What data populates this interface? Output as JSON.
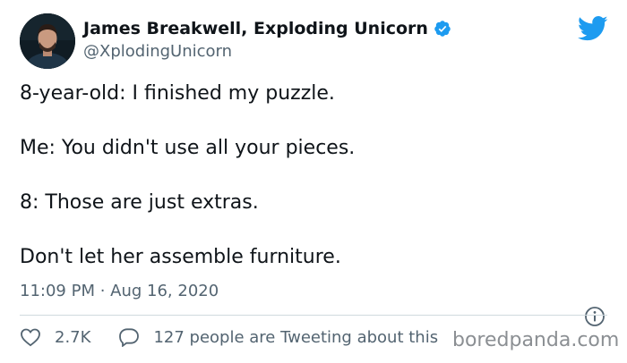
{
  "author": {
    "display_name": "James Breakwell, Exploding Unicorn",
    "handle": "@XplodingUnicorn",
    "avatar_icon": "profile-photo",
    "verified_icon": "verified-badge-icon"
  },
  "tweet": {
    "lines": [
      "8-year-old: I finished my puzzle.",
      "Me: You didn't use all your pieces.",
      "8: Those are just extras.",
      "Don't let her assemble furniture."
    ],
    "timestamp": "11:09 PM · Aug 16, 2020"
  },
  "actions": {
    "like_count": "2.7K",
    "reply_text": "127 people are Tweeting about this"
  },
  "watermark": "boredpanda.com",
  "colors": {
    "twitter_blue": "#1d9bf0",
    "text_primary": "#0f1419",
    "text_secondary": "#536471",
    "divider": "#cfd9de"
  },
  "icons": {
    "brand": "twitter-bird-icon",
    "info": "info-icon",
    "like": "heart-icon",
    "reply": "speech-bubble-icon"
  }
}
